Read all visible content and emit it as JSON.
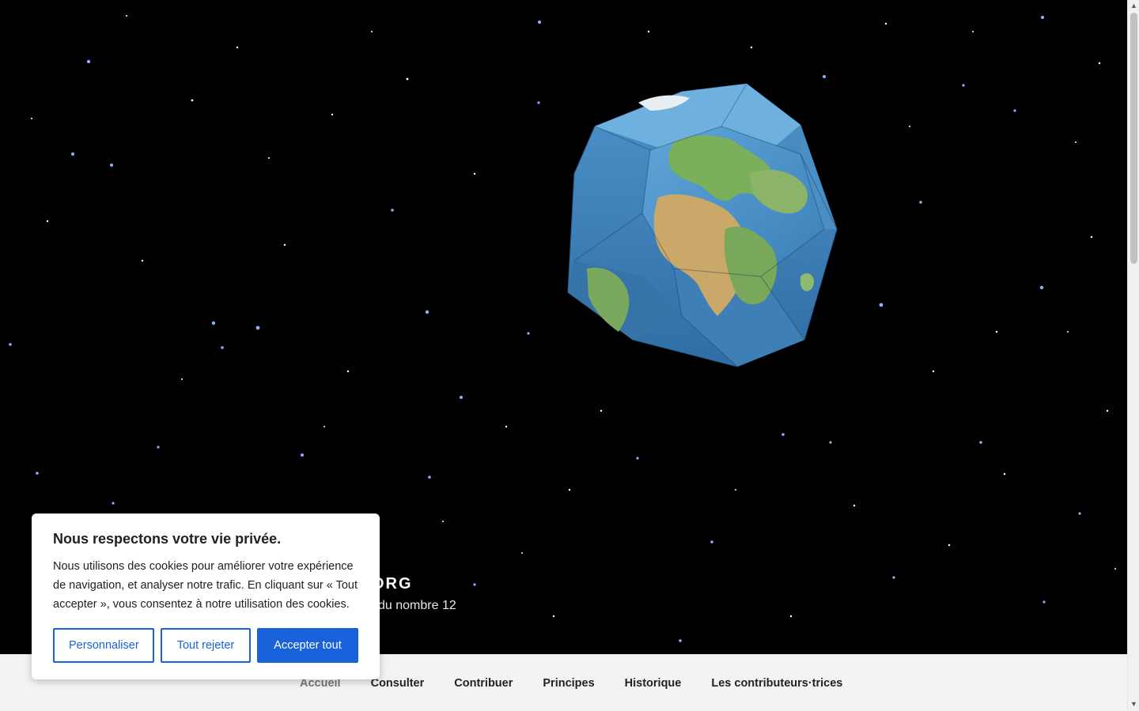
{
  "site": {
    "title": "ORG",
    "description": "du nombre 12"
  },
  "nav": {
    "items": [
      {
        "label": "Accueil",
        "current": true
      },
      {
        "label": "Consulter",
        "current": false
      },
      {
        "label": "Contribuer",
        "current": false
      },
      {
        "label": "Principes",
        "current": false
      },
      {
        "label": "Historique",
        "current": false
      },
      {
        "label": "Les contributeurs·trices",
        "current": false
      }
    ]
  },
  "cookie": {
    "title": "Nous respectons votre vie privée.",
    "text": "Nous utilisons des cookies pour améliorer votre expérience de navigation, et analyser notre trafic. En cliquant sur « Tout accepter », vous consentez à notre utilisation des cookies.",
    "customize_label": "Personnaliser",
    "reject_label": "Tout rejeter",
    "accept_label": "Accepter tout"
  },
  "colors": {
    "accent": "#1863dc",
    "nav_bg": "#f3f3f3"
  },
  "icons": {
    "scroll_up": "triangle-up-icon",
    "scroll_down": "triangle-down-icon"
  }
}
